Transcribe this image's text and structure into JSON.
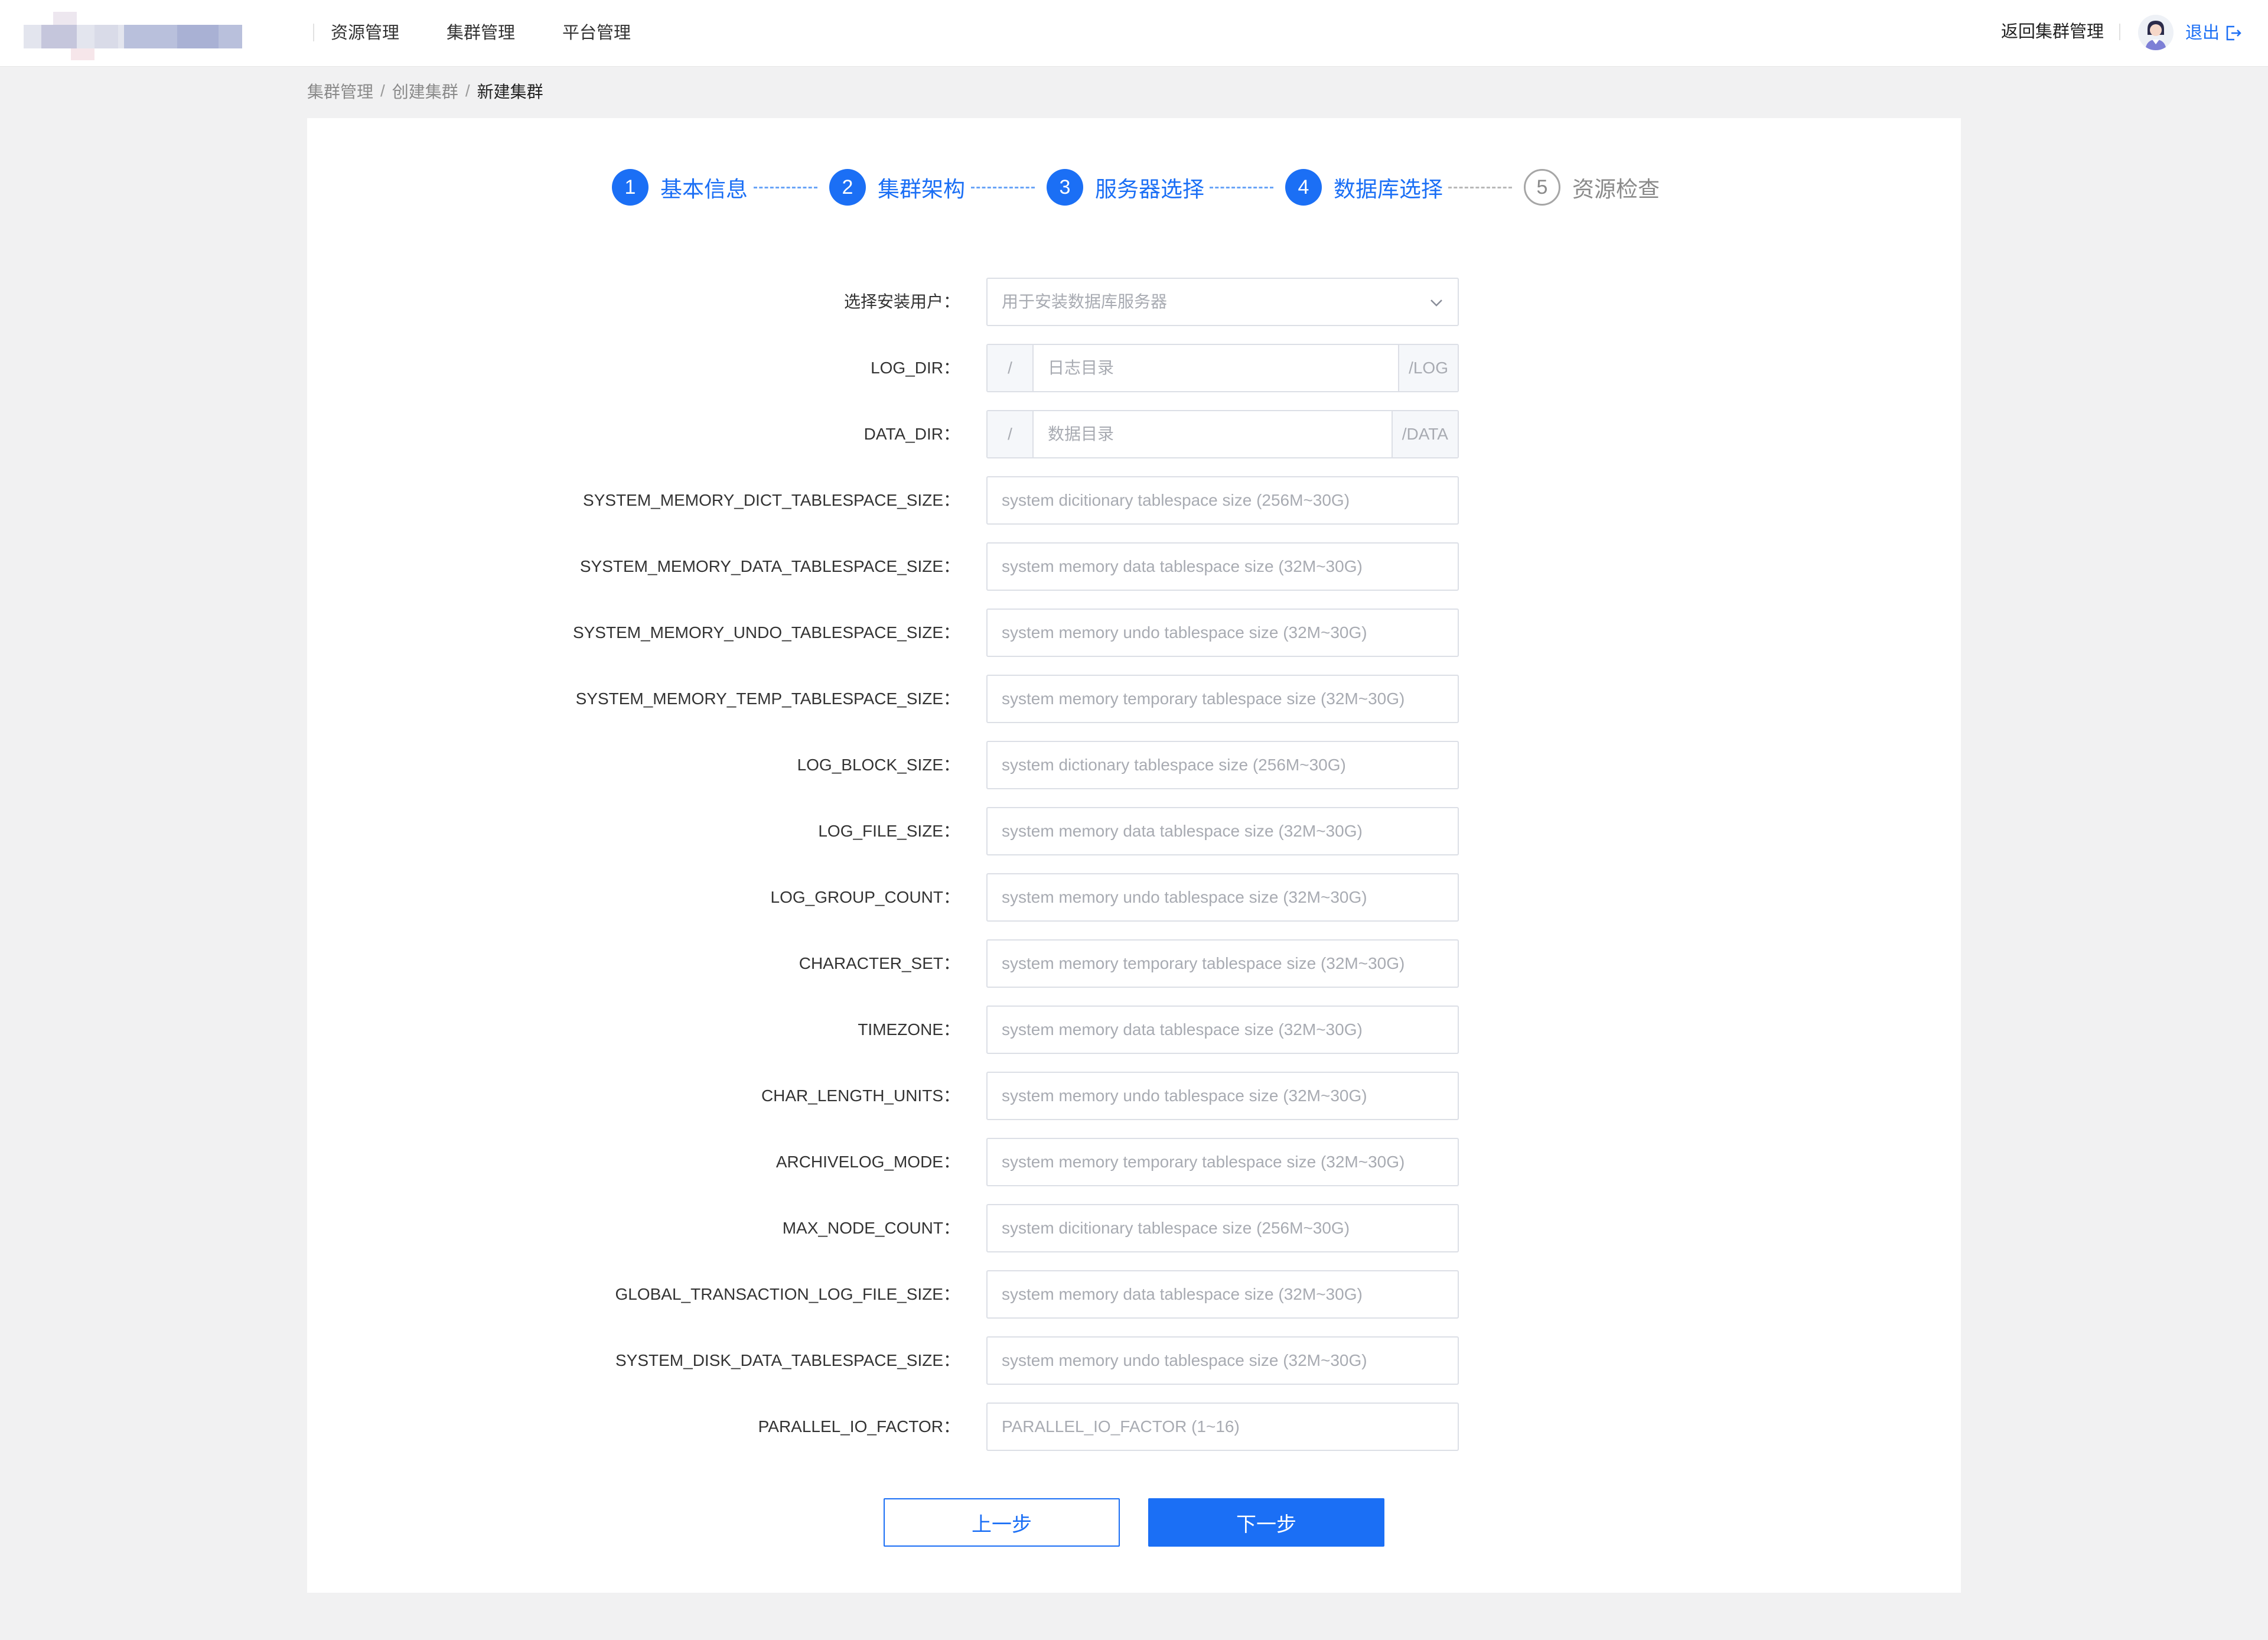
{
  "header": {
    "nav": [
      "资源管理",
      "集群管理",
      "平台管理"
    ],
    "return_label": "返回集群管理",
    "logout_label": "退出"
  },
  "breadcrumb": [
    "集群管理",
    "创建集群",
    "新建集群"
  ],
  "breadcrumb_separator": "/",
  "steps": [
    {
      "num": "1",
      "label": "基本信息",
      "state": "done"
    },
    {
      "num": "2",
      "label": "集群架构",
      "state": "done"
    },
    {
      "num": "3",
      "label": "服务器选择",
      "state": "done"
    },
    {
      "num": "4",
      "label": "数据库选择",
      "state": "active"
    },
    {
      "num": "5",
      "label": "资源检查",
      "state": "pending"
    }
  ],
  "form": {
    "install_user": {
      "label": "选择安装用户：",
      "placeholder": "用于安装数据库服务器"
    },
    "log_dir": {
      "label": "LOG_DIR：",
      "prefix": "/",
      "placeholder": "日志目录",
      "suffix": "/LOG"
    },
    "data_dir": {
      "label": "DATA_DIR：",
      "prefix": "/",
      "placeholder": "数据目录",
      "suffix": "/DATA"
    },
    "fields": [
      {
        "label": "SYSTEM_MEMORY_DICT_TABLESPACE_SIZE：",
        "placeholder": "system dicitionary tablespace size (256M~30G)"
      },
      {
        "label": "SYSTEM_MEMORY_DATA_TABLESPACE_SIZE：",
        "placeholder": "system memory data tablespace size (32M~30G)"
      },
      {
        "label": "SYSTEM_MEMORY_UNDO_TABLESPACE_SIZE：",
        "placeholder": "system memory undo tablespace size (32M~30G)"
      },
      {
        "label": "SYSTEM_MEMORY_TEMP_TABLESPACE_SIZE：",
        "placeholder": "system memory temporary tablespace size (32M~30G)"
      },
      {
        "label": "LOG_BLOCK_SIZE：",
        "placeholder": "system dictionary tablespace size (256M~30G)"
      },
      {
        "label": "LOG_FILE_SIZE：",
        "placeholder": "system memory data tablespace size (32M~30G)"
      },
      {
        "label": "LOG_GROUP_COUNT：",
        "placeholder": "system memory undo tablespace size (32M~30G)"
      },
      {
        "label": "CHARACTER_SET：",
        "placeholder": "system memory temporary tablespace size (32M~30G)"
      },
      {
        "label": "TIMEZONE：",
        "placeholder": "system memory data tablespace size (32M~30G)"
      },
      {
        "label": "CHAR_LENGTH_UNITS：",
        "placeholder": "system memory undo tablespace size (32M~30G)"
      },
      {
        "label": "ARCHIVELOG_MODE：",
        "placeholder": "system memory temporary tablespace size (32M~30G)"
      },
      {
        "label": "MAX_NODE_COUNT：",
        "placeholder": "system dicitionary tablespace size (256M~30G)"
      },
      {
        "label": "GLOBAL_TRANSACTION_LOG_FILE_SIZE：",
        "placeholder": "system memory data tablespace size (32M~30G)"
      },
      {
        "label": "SYSTEM_DISK_DATA_TABLESPACE_SIZE：",
        "placeholder": "system memory undo tablespace size (32M~30G)"
      },
      {
        "label": "PARALLEL_IO_FACTOR：",
        "placeholder": "PARALLEL_IO_FACTOR (1~16)"
      }
    ]
  },
  "buttons": {
    "prev": "上一步",
    "next": "下一步"
  },
  "colors": {
    "accent": "#1b6ff5",
    "pending": "#8a8a8a",
    "border": "#dcdfe6",
    "page_bg": "#f1f1f2"
  }
}
